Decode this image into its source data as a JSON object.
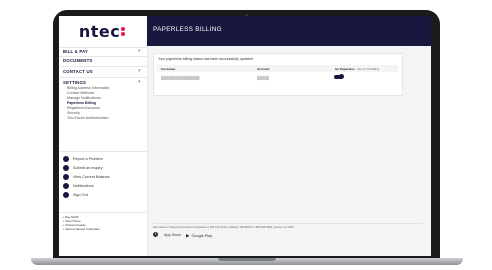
{
  "brand": {
    "logo_text": "ntec"
  },
  "header": {
    "title": "PAPERLESS BILLING"
  },
  "sidebar": {
    "sections": [
      {
        "label": "BILL & PAY",
        "chevron": "˅"
      },
      {
        "label": "DOCUMENTS",
        "chevron": ""
      },
      {
        "label": "CONTACT US",
        "chevron": "˅"
      },
      {
        "label": "SETTINGS",
        "chevron": "˄"
      }
    ],
    "settings_items": [
      "Billing Address Information",
      "Contact Methods",
      "Manage Notifications",
      "Paperless Billing",
      "Registered Accounts",
      "Security",
      "Two-Factor Authentication"
    ],
    "actions": [
      {
        "label": "Report a Problem",
        "icon": "wrench-icon"
      },
      {
        "label": "Submit an Inquiry",
        "icon": "chat-icon"
      },
      {
        "label": "View Current Balance",
        "icon": "balance-icon"
      },
      {
        "label": "Notifications",
        "icon": "bell-icon"
      },
      {
        "label": "Sign Out",
        "icon": "signout-icon"
      }
    ],
    "footer_links": [
      "Pay NOW",
      "View Home",
      "Channel Guide",
      "Internet Speed Calculator"
    ]
  },
  "main": {
    "message": "Your paperless billing status has been successfully updated",
    "columns": [
      "Customer",
      "Account",
      "Go Paperless",
      "(As of 7/1/2021)"
    ],
    "row": {
      "customer": "████████████████",
      "account": "█████",
      "paperless_on": true
    }
  },
  "footer": {
    "text": "New Hanover Telecommunications Cooperative   |   300 Pink Street, Oakland, NE 68045   |   1-800-528-3066   |   Version 1.0.2000",
    "store_apple": "App Store",
    "store_google": "Google Play",
    "social_icon": "f"
  },
  "colors": {
    "navy": "#17173f",
    "accent": "#e8174a"
  }
}
